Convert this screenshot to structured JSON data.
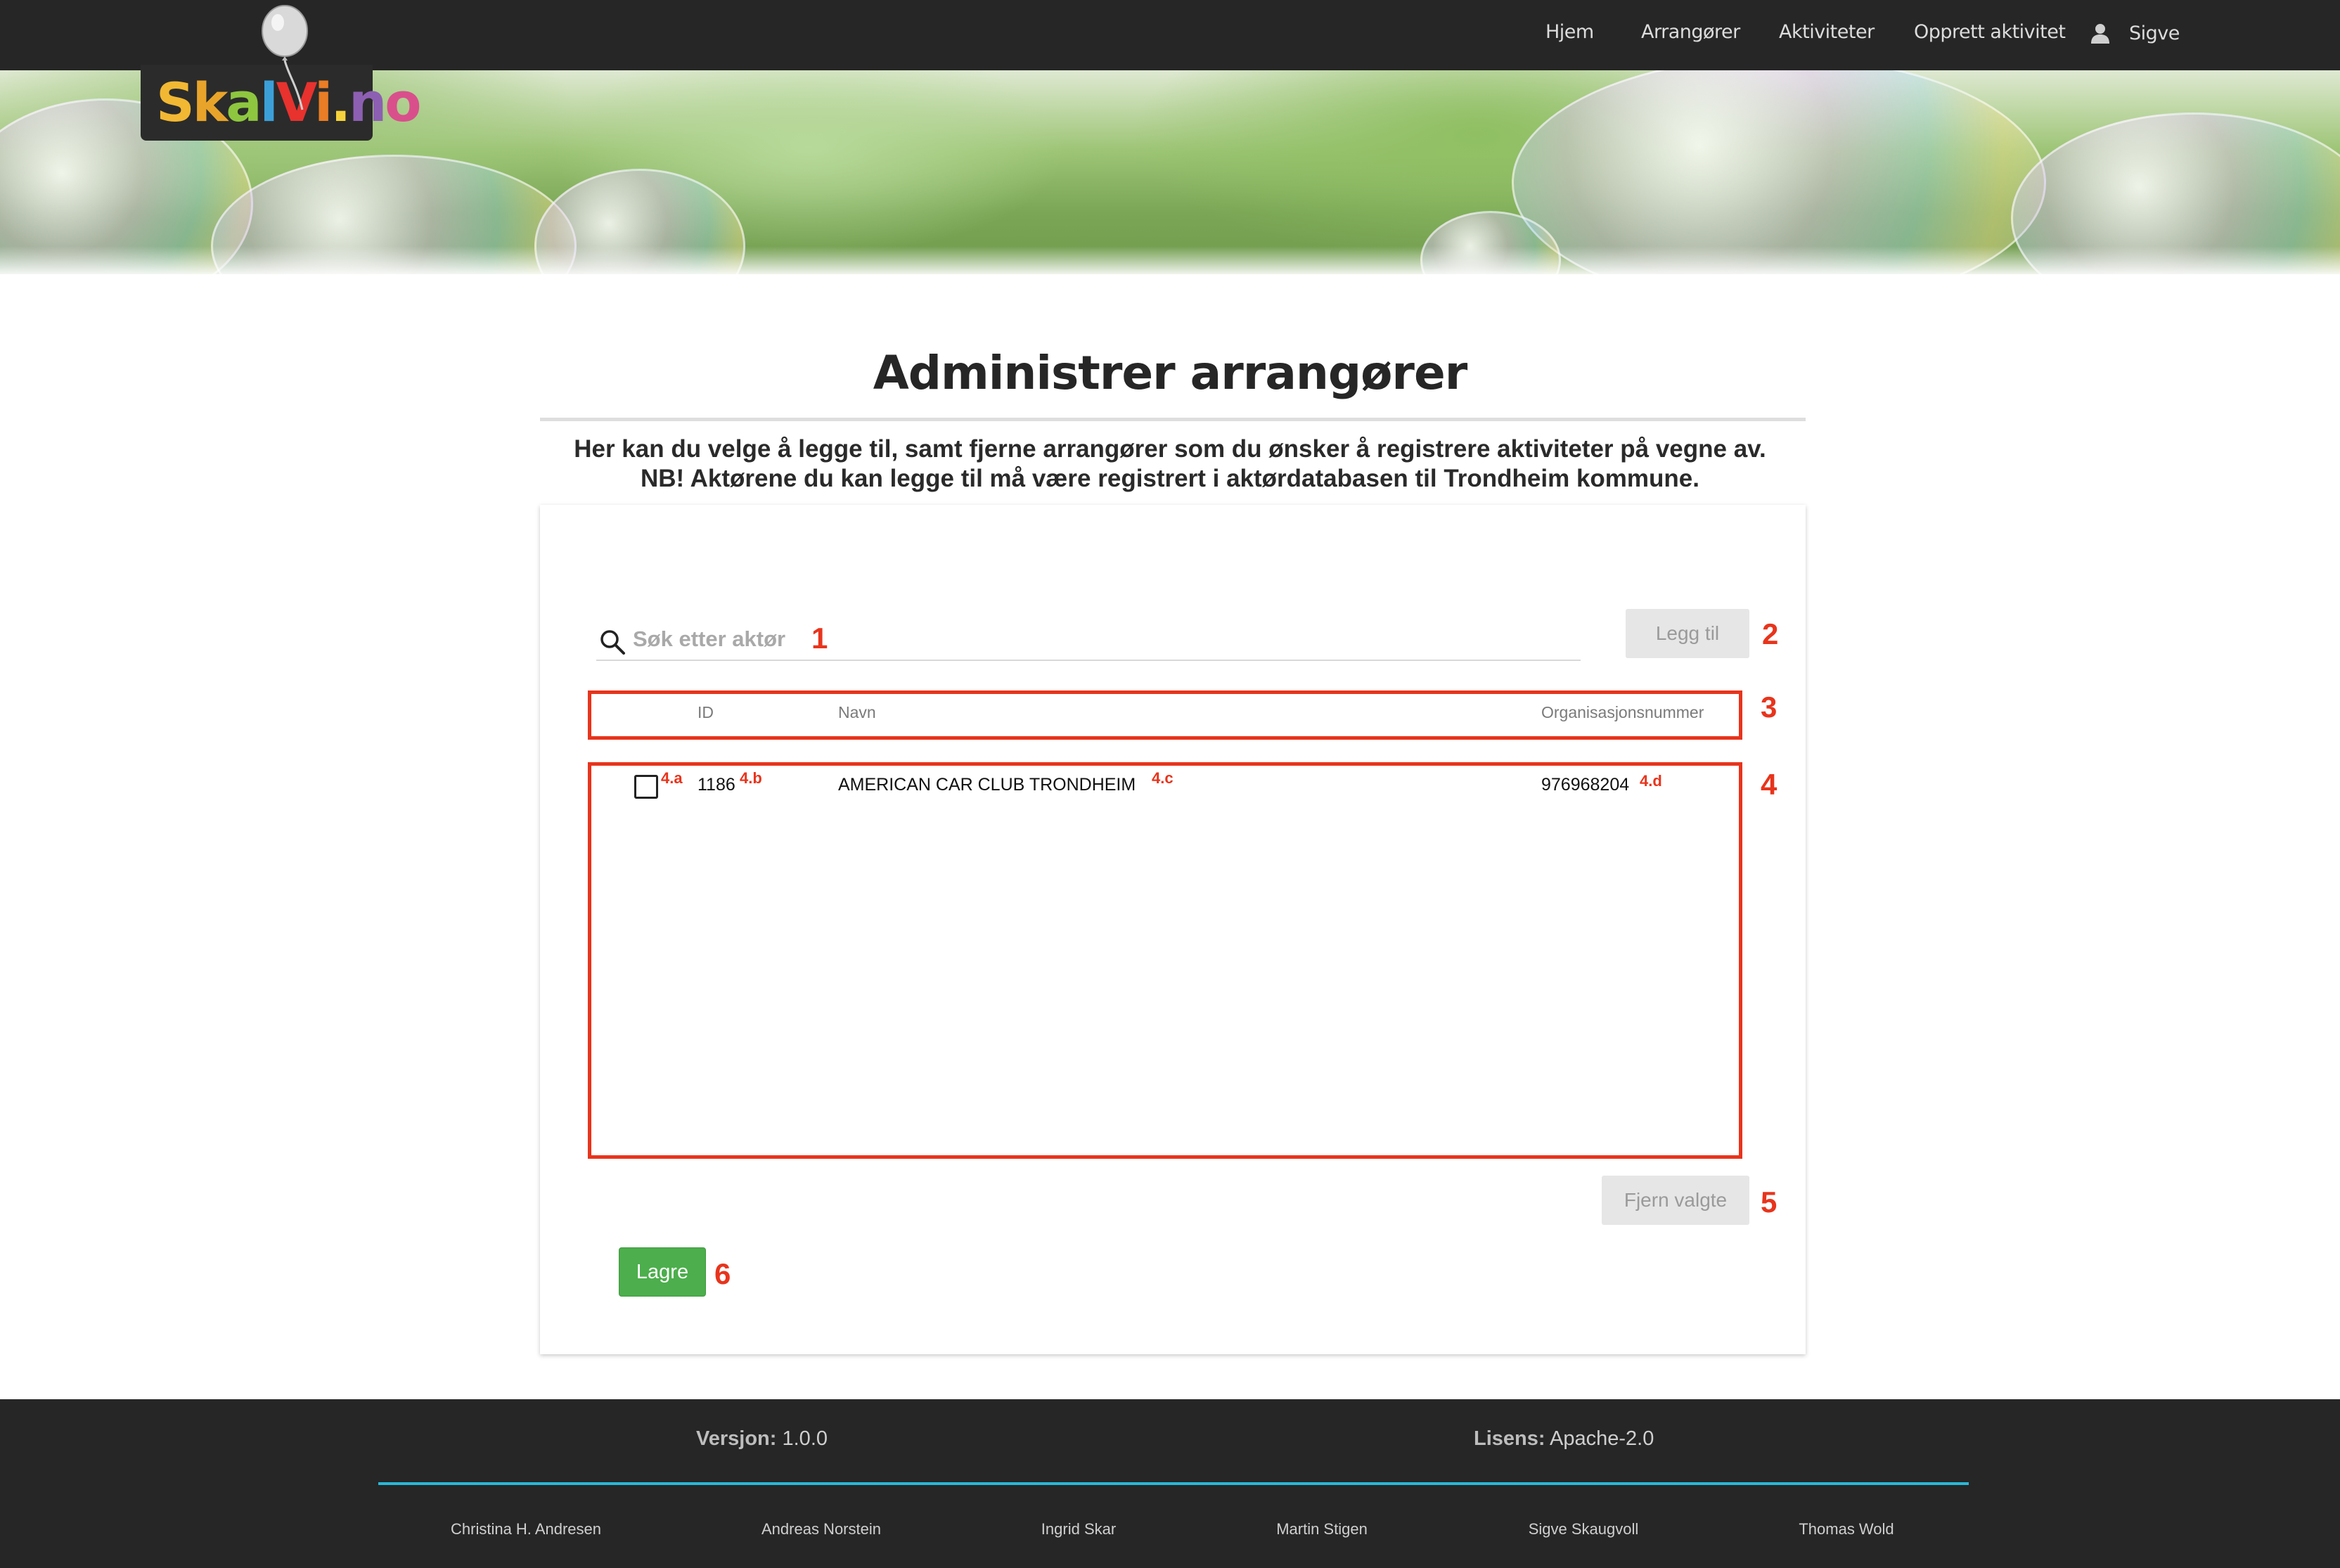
{
  "nav": {
    "items": [
      "Hjem",
      "Arrangører",
      "Aktiviteter",
      "Opprett aktivitet"
    ],
    "user_name": "Sigve",
    "user_icon": "user-icon"
  },
  "logo": {
    "text_parts": [
      "S",
      "k",
      "a",
      "l",
      "V",
      "i",
      ".",
      "n",
      "o"
    ],
    "colors": [
      "#f2b833",
      "#e8a42a",
      "#8ec63f",
      "#3ba0d8",
      "#e7322e",
      "#ea7d25",
      "#f6d33c",
      "#8d5fb3",
      "#d94f8c"
    ]
  },
  "page": {
    "title": "Administrer arrangører",
    "intro_line1": "Her kan du velge å legge til, samt fjerne arrangører som du ønsker å registrere aktiviteter på vegne av.",
    "intro_line2": "NB! Aktørene du kan legge til må være registrert i aktørdatabasen til Trondheim kommune."
  },
  "search": {
    "placeholder": "Søk etter aktør",
    "icon": "search-icon",
    "value": ""
  },
  "buttons": {
    "add": "Legg til",
    "remove": "Fjern valgte",
    "save": "Lagre"
  },
  "table": {
    "headers": [
      "ID",
      "Navn",
      "Organisasjonsnummer"
    ],
    "rows": [
      {
        "checked": false,
        "id": "1186",
        "name": "AMERICAN CAR CLUB TRONDHEIM",
        "org": "976968204"
      }
    ]
  },
  "annotations": {
    "numbers": [
      "1",
      "2",
      "3",
      "4",
      "5",
      "6"
    ],
    "sub": [
      "4.a",
      "4.b",
      "4.c",
      "4.d"
    ],
    "color": "#e8341c"
  },
  "footer": {
    "version_label": "Versjon:",
    "version_value": "1.0.0",
    "license_label": "Lisens:",
    "license_value": "Apache-2.0",
    "authors": [
      "Christina H. Andresen",
      "Andreas Norstein",
      "Ingrid Skar",
      "Martin Stigen",
      "Sigve Skaugvoll",
      "Thomas Wold"
    ],
    "accent": "#29b8d8"
  }
}
